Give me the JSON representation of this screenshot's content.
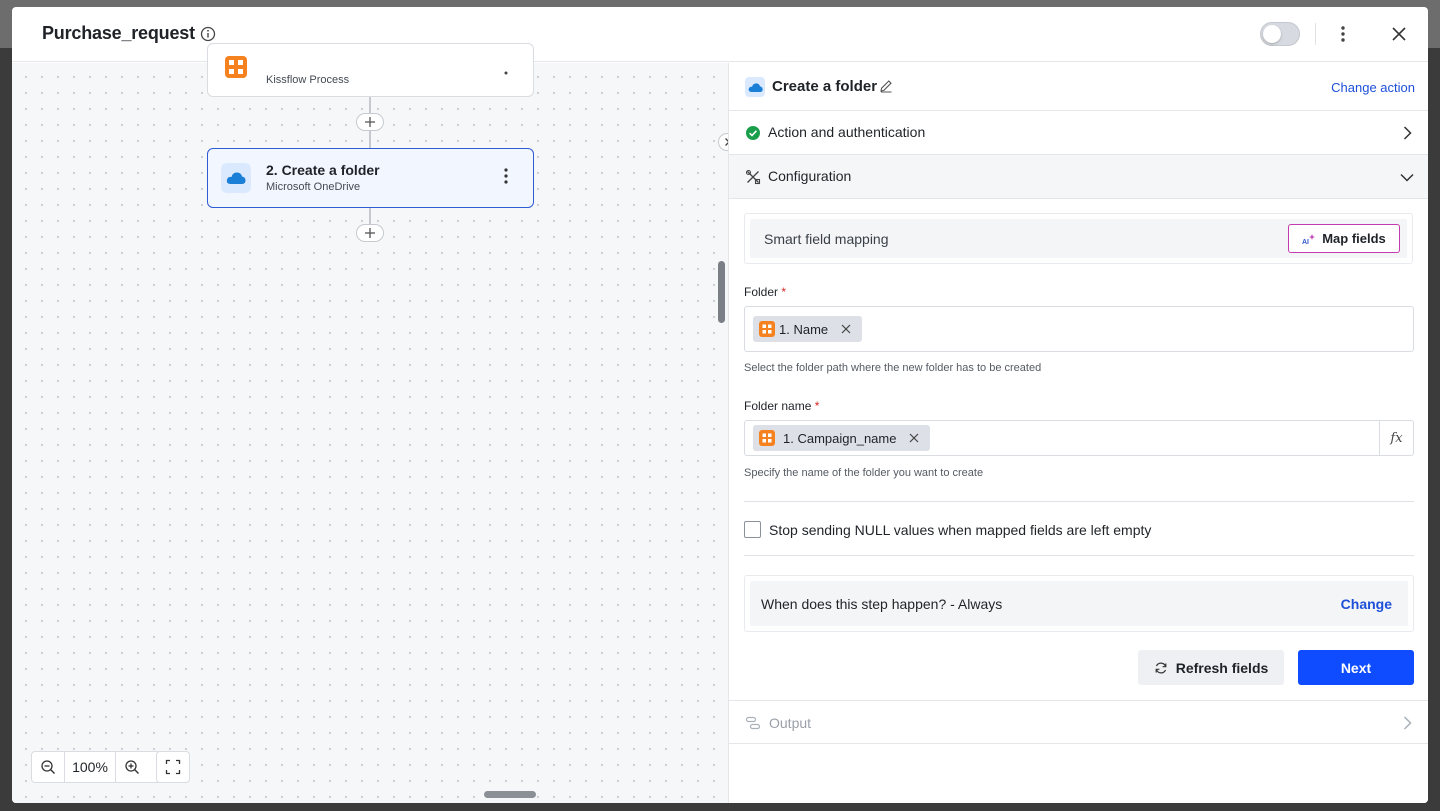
{
  "header": {
    "title": "Purchase_request",
    "toggle_state": "off"
  },
  "canvas": {
    "nodes": [
      {
        "title": "",
        "subtitle": "Kissflow Process",
        "icon": "kissflow-icon"
      },
      {
        "title": "2. Create a folder",
        "subtitle": "Microsoft OneDrive",
        "icon": "onedrive-cloud-icon",
        "selected": true
      }
    ],
    "zoom": {
      "value": "100%"
    }
  },
  "panel": {
    "title": "Create a folder",
    "change_action": "Change action",
    "sections": {
      "auth": "Action and authentication",
      "config": "Configuration",
      "output": "Output"
    },
    "smart_mapping": {
      "label": "Smart field mapping",
      "button": "Map fields"
    },
    "folder": {
      "label": "Folder",
      "chip": "1. Name",
      "help": "Select the folder path where the new folder has to be created"
    },
    "folder_name": {
      "label": "Folder name",
      "chip": "1. Campaign_name",
      "help": "Specify the name of the folder you want to create",
      "fx": "fx"
    },
    "null_checkbox": {
      "label": "Stop sending NULL values when mapped fields are left empty",
      "checked": false
    },
    "when": {
      "label": "When does this step happen? - Always",
      "change": "Change"
    },
    "buttons": {
      "refresh": "Refresh fields",
      "next": "Next"
    }
  },
  "colors": {
    "accent_blue": "#0f4cff",
    "link_blue": "#1d4fd8",
    "success_green": "#1a9e4b",
    "kissflow_orange": "#f5821f",
    "required_red": "#e02424",
    "map_border": "#c23bb0"
  }
}
